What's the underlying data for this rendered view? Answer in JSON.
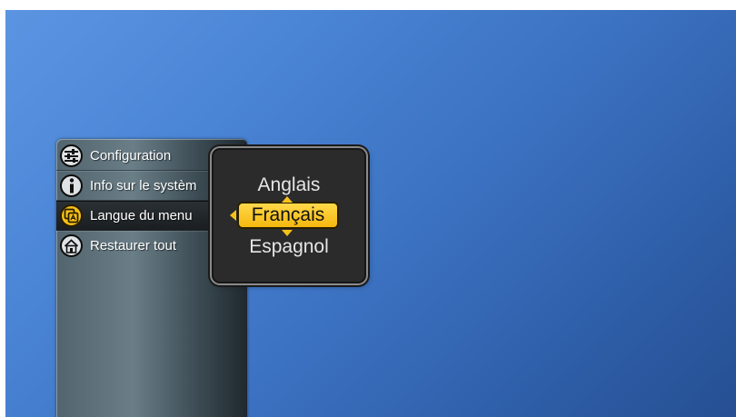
{
  "menu": {
    "items": [
      {
        "label": "Configuration",
        "icon": "sliders-icon",
        "active": false
      },
      {
        "label": "Info sur le systèm",
        "icon": "info-icon",
        "active": false
      },
      {
        "label": "Langue du menu",
        "icon": "language-icon",
        "active": true
      },
      {
        "label": "Restaurer tout",
        "icon": "home-icon",
        "active": false
      }
    ]
  },
  "language_picker": {
    "previous": "Anglais",
    "selected": "Français",
    "next": "Espagnol"
  },
  "colors": {
    "background": "#3c72c2",
    "highlight": "#f6b80e",
    "panel": "#5c6f78"
  }
}
